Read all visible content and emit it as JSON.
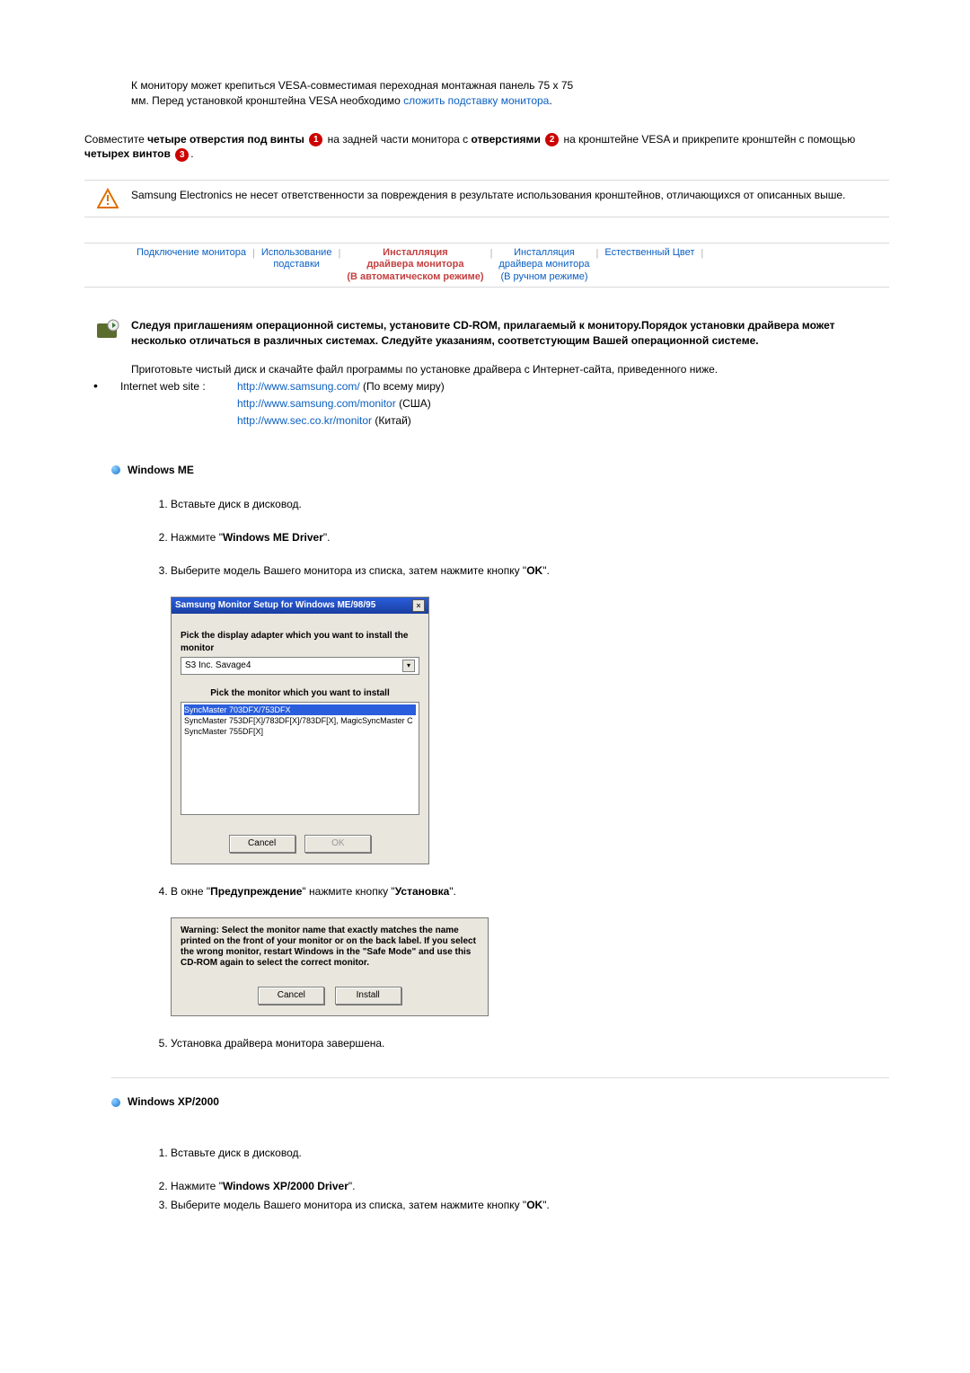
{
  "vesa_box": {
    "line1": "К монитору может крепиться VESA-совместимая переходная монтажная панель 75 x 75",
    "line2_a": "мм. Перед установкой кронштейна VESA необходимо ",
    "line2_link": "сложить подставку монитора",
    "line2_b": "."
  },
  "align_para": {
    "a": "Совместите ",
    "bold1": "четыре отверстия под винты ",
    "mid1": " на задней части монитора с ",
    "bold2": "отверстиями ",
    "mid2": " на кронштейне VESA и прикрепите кронштейн с помощью ",
    "bold3": "четырех винтов ",
    "end": "."
  },
  "circles": {
    "one": "1",
    "two": "2",
    "three": "3"
  },
  "warning_box": "Samsung Electronics не несет ответственности за повреждения в результате использования кронштейнов, отличающихся от описанных выше.",
  "menu": {
    "item1": "Подключение монитора",
    "item2a": "Использование",
    "item2b": "подставки",
    "item3a": "Инсталляция",
    "item3b": "драйвера монитора",
    "item3c": "(В автоматическом режиме)",
    "item4a": "Инсталляция",
    "item4b": "драйвера монитора",
    "item4c": "(В ручном режиме)",
    "item5": "Естественный Цвет",
    "sep": "|"
  },
  "cdrom_section": {
    "bold": "Следуя приглашениям операционной системы, установите CD-ROM, прилагаемый к монитору.Порядок установки драйвера может несколько отличаться в различных системах. Следуйте указаниям, соответстующим Вашей операционной системе.",
    "p2": "Приготовьте чистый диск и скачайте файл программы по установке драйвера с Интернет-сайта, приведенного ниже."
  },
  "sites": {
    "label": "Internet web site :",
    "l1_url": "http://www.samsung.com/",
    "l1_tail": " (По всему миру)",
    "l2_url": "http://www.samsung.com/monitor",
    "l2_tail": " (США)",
    "l3_url": "http://www.sec.co.kr/monitor",
    "l3_tail": " (Китай)"
  },
  "win_me": {
    "title": "Windows ME",
    "s1": "Вставьте диск в дисковод.",
    "s2a": "Нажмите \"",
    "s2b": "Windows ME Driver",
    "s2c": "\".",
    "s3a": "Выберите модель Вашего монитора из списка, затем нажмите кнопку \"",
    "s3b": "OK",
    "s3c": "\".",
    "s4a": "В окне \"",
    "s4b": "Предупреждение",
    "s4c": "\" нажмите кнопку \"",
    "s4d": "Установка",
    "s4e": "\".",
    "s5": "Установка драйвера монитора завершена."
  },
  "dlg1": {
    "title": "Samsung Monitor Setup for Windows  ME/98/95",
    "lbl1": "Pick the display adapter which you want to install the monitor",
    "combo_value": "S3 Inc. Savage4",
    "lbl2": "Pick the monitor which you want to install",
    "list": [
      "SyncMaster 703DFX/753DFX",
      "SyncMaster 753DF[X]/783DF[X]/783DF[X], MagicSyncMaster C",
      "SyncMaster 755DF[X]"
    ],
    "btn_cancel": "Cancel",
    "btn_ok": "OK"
  },
  "dlg2": {
    "text": "Warning: Select the monitor name that exactly matches the name printed on the front of your monitor or on the back label. If you select the wrong monitor, restart Windows in the \"Safe Mode\" and use this CD-ROM again to select the correct monitor.",
    "btn_cancel": "Cancel",
    "btn_install": "Install"
  },
  "win_xp": {
    "title": "Windows XP/2000",
    "s1": "Вставьте диск в дисковод.",
    "s2a": "Нажмите \"",
    "s2b": "Windows XP/2000 Driver",
    "s2c": "\".",
    "s3a": "Выберите модель Вашего монитора из списка, затем нажмите кнопку \"",
    "s3b": "OK",
    "s3c": "\"."
  }
}
